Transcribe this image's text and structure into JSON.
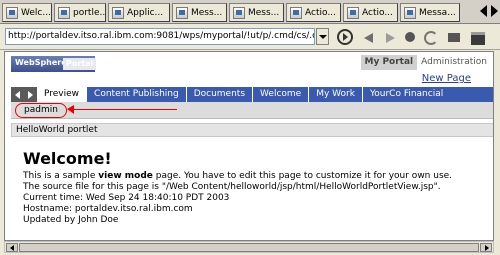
{
  "window_tabs": [
    {
      "label": "Welc...",
      "icon": "page-icon"
    },
    {
      "label": "portle...",
      "icon": "page-icon"
    },
    {
      "label": "Applic...",
      "icon": "page-icon"
    },
    {
      "label": "Mess...",
      "icon": "page-icon"
    },
    {
      "label": "Mess...",
      "icon": "page-icon"
    },
    {
      "label": "Actio...",
      "icon": "page-icon"
    },
    {
      "label": "Actio...",
      "icon": "page-icon"
    },
    {
      "label": "Messa...",
      "icon": "page-icon"
    }
  ],
  "address": {
    "url": "http://portaldev.itso.ral.ibm.com:9081/wps/myportal/!ut/p/.cmd/cs/.ce/7_"
  },
  "portal": {
    "logo_brand": "WebSphere",
    "logo_product": "Portal",
    "top_links": [
      "My Portal",
      "Administration"
    ],
    "new_page": "New Page"
  },
  "tabs": [
    "Preview",
    "Content Publishing",
    "Documents",
    "Welcome",
    "My Work",
    "YourCo Financial"
  ],
  "active_tab": "Preview",
  "user": "padmin",
  "portlet": {
    "title": "HelloWorld portlet",
    "heading": "Welcome!",
    "line1_pre": "This is a sample ",
    "line1_bold": "view mode",
    "line1_post": " page. You have to edit this page to customize it for your own use.",
    "line2": "The source file for this page is \"/Web Content/helloworld/jsp/html/HelloWorldPortletView.jsp\".",
    "line3": "Current time: Wed Sep 24 18:40:10 PDT 2003",
    "line4": "Hostname: portaldev.itso.ral.ibm.com",
    "line5": "Updated by John Doe"
  },
  "colors": {
    "tab_bar": "#3a5ab0",
    "annotation": "#e00000"
  }
}
